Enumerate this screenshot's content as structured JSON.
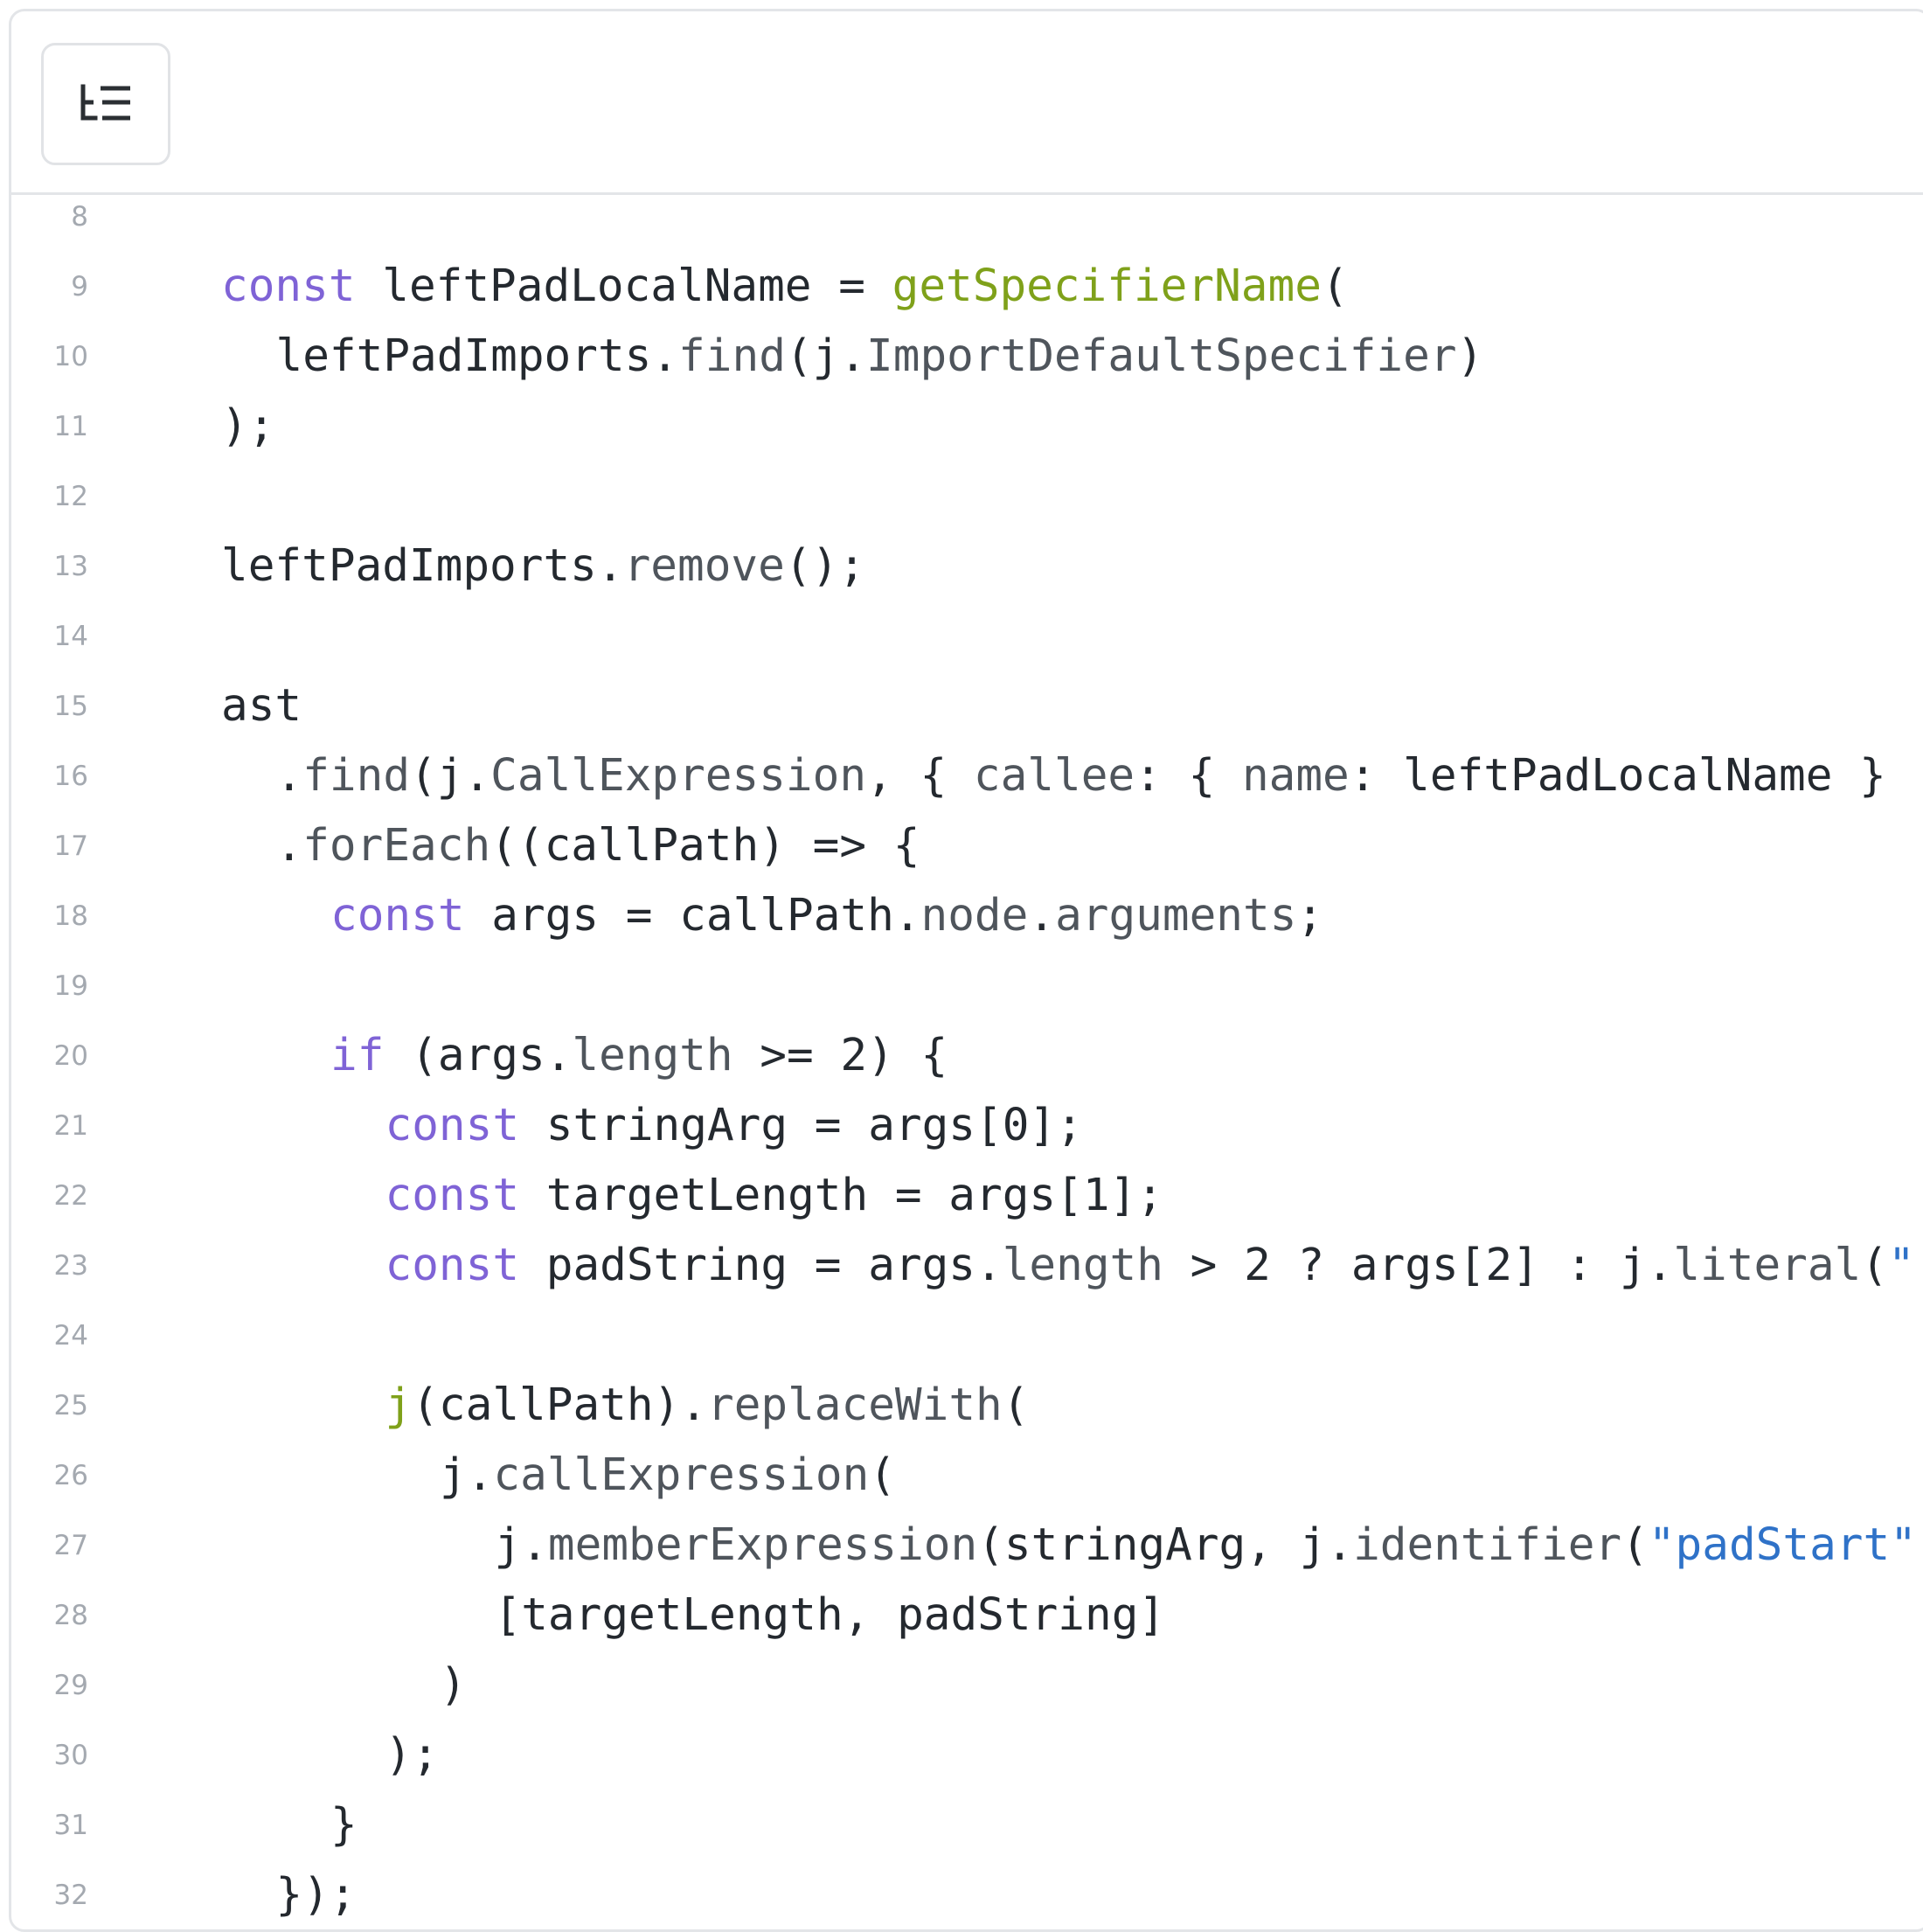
{
  "toolbar": {
    "outline_icon": "outline-list-icon"
  },
  "code": {
    "lines": [
      {
        "number": "8",
        "indent": 0,
        "tokens": []
      },
      {
        "number": "9",
        "indent": 0,
        "tokens": [
          {
            "t": "const",
            "c": "k"
          },
          {
            "t": " leftPadLocalName = "
          },
          {
            "t": "getSpecifierName",
            "c": "f"
          },
          {
            "t": "("
          }
        ]
      },
      {
        "number": "10",
        "indent": 1,
        "tokens": [
          {
            "t": "leftPadImports."
          },
          {
            "t": "find",
            "c": "m"
          },
          {
            "t": "(j."
          },
          {
            "t": "ImportDefaultSpecifier",
            "c": "m"
          },
          {
            "t": ")"
          }
        ]
      },
      {
        "number": "11",
        "indent": 0,
        "tokens": [
          {
            "t": ");"
          }
        ]
      },
      {
        "number": "12",
        "indent": 0,
        "tokens": []
      },
      {
        "number": "13",
        "indent": 0,
        "tokens": [
          {
            "t": "leftPadImports."
          },
          {
            "t": "remove",
            "c": "m"
          },
          {
            "t": "();"
          }
        ]
      },
      {
        "number": "14",
        "indent": 0,
        "tokens": []
      },
      {
        "number": "15",
        "indent": 0,
        "tokens": [
          {
            "t": "ast"
          }
        ]
      },
      {
        "number": "16",
        "indent": 1,
        "tokens": [
          {
            "t": "."
          },
          {
            "t": "find",
            "c": "m"
          },
          {
            "t": "(j."
          },
          {
            "t": "CallExpression",
            "c": "m"
          },
          {
            "t": ", { "
          },
          {
            "t": "callee",
            "c": "m"
          },
          {
            "t": ": { "
          },
          {
            "t": "name",
            "c": "m"
          },
          {
            "t": ": leftPadLocalName }"
          }
        ]
      },
      {
        "number": "17",
        "indent": 1,
        "tokens": [
          {
            "t": "."
          },
          {
            "t": "forEach",
            "c": "m"
          },
          {
            "t": "((callPath) => {"
          }
        ]
      },
      {
        "number": "18",
        "indent": 2,
        "tokens": [
          {
            "t": "const",
            "c": "k"
          },
          {
            "t": " args = callPath."
          },
          {
            "t": "node",
            "c": "m"
          },
          {
            "t": "."
          },
          {
            "t": "arguments",
            "c": "m"
          },
          {
            "t": ";"
          }
        ]
      },
      {
        "number": "19",
        "indent": 0,
        "tokens": []
      },
      {
        "number": "20",
        "indent": 2,
        "tokens": [
          {
            "t": "if",
            "c": "k"
          },
          {
            "t": " (args."
          },
          {
            "t": "length",
            "c": "m"
          },
          {
            "t": " >= 2) {"
          }
        ]
      },
      {
        "number": "21",
        "indent": 3,
        "tokens": [
          {
            "t": "const",
            "c": "k"
          },
          {
            "t": " stringArg = args[0];"
          }
        ]
      },
      {
        "number": "22",
        "indent": 3,
        "tokens": [
          {
            "t": "const",
            "c": "k"
          },
          {
            "t": " targetLength = args[1];"
          }
        ]
      },
      {
        "number": "23",
        "indent": 3,
        "tokens": [
          {
            "t": "const",
            "c": "k"
          },
          {
            "t": " padString = args."
          },
          {
            "t": "length",
            "c": "m"
          },
          {
            "t": " > 2 ? args[2] : j."
          },
          {
            "t": "literal",
            "c": "m"
          },
          {
            "t": "("
          },
          {
            "t": "\"",
            "c": "s"
          }
        ]
      },
      {
        "number": "24",
        "indent": 0,
        "tokens": []
      },
      {
        "number": "25",
        "indent": 3,
        "tokens": [
          {
            "t": "j",
            "c": "f"
          },
          {
            "t": "(callPath)."
          },
          {
            "t": "replaceWith",
            "c": "m"
          },
          {
            "t": "("
          }
        ]
      },
      {
        "number": "26",
        "indent": 4,
        "tokens": [
          {
            "t": "j."
          },
          {
            "t": "callExpression",
            "c": "m"
          },
          {
            "t": "("
          }
        ]
      },
      {
        "number": "27",
        "indent": 5,
        "tokens": [
          {
            "t": "j."
          },
          {
            "t": "memberExpression",
            "c": "m"
          },
          {
            "t": "(stringArg, j."
          },
          {
            "t": "identifier",
            "c": "m"
          },
          {
            "t": "("
          },
          {
            "t": "\"padStart\"",
            "c": "s"
          }
        ]
      },
      {
        "number": "28",
        "indent": 5,
        "tokens": [
          {
            "t": "[targetLength, padString]"
          }
        ]
      },
      {
        "number": "29",
        "indent": 4,
        "tokens": [
          {
            "t": ")"
          }
        ]
      },
      {
        "number": "30",
        "indent": 3,
        "tokens": [
          {
            "t": ");"
          }
        ]
      },
      {
        "number": "31",
        "indent": 2,
        "tokens": [
          {
            "t": "}"
          }
        ]
      },
      {
        "number": "32",
        "indent": 1,
        "tokens": [
          {
            "t": "});"
          }
        ]
      }
    ]
  }
}
